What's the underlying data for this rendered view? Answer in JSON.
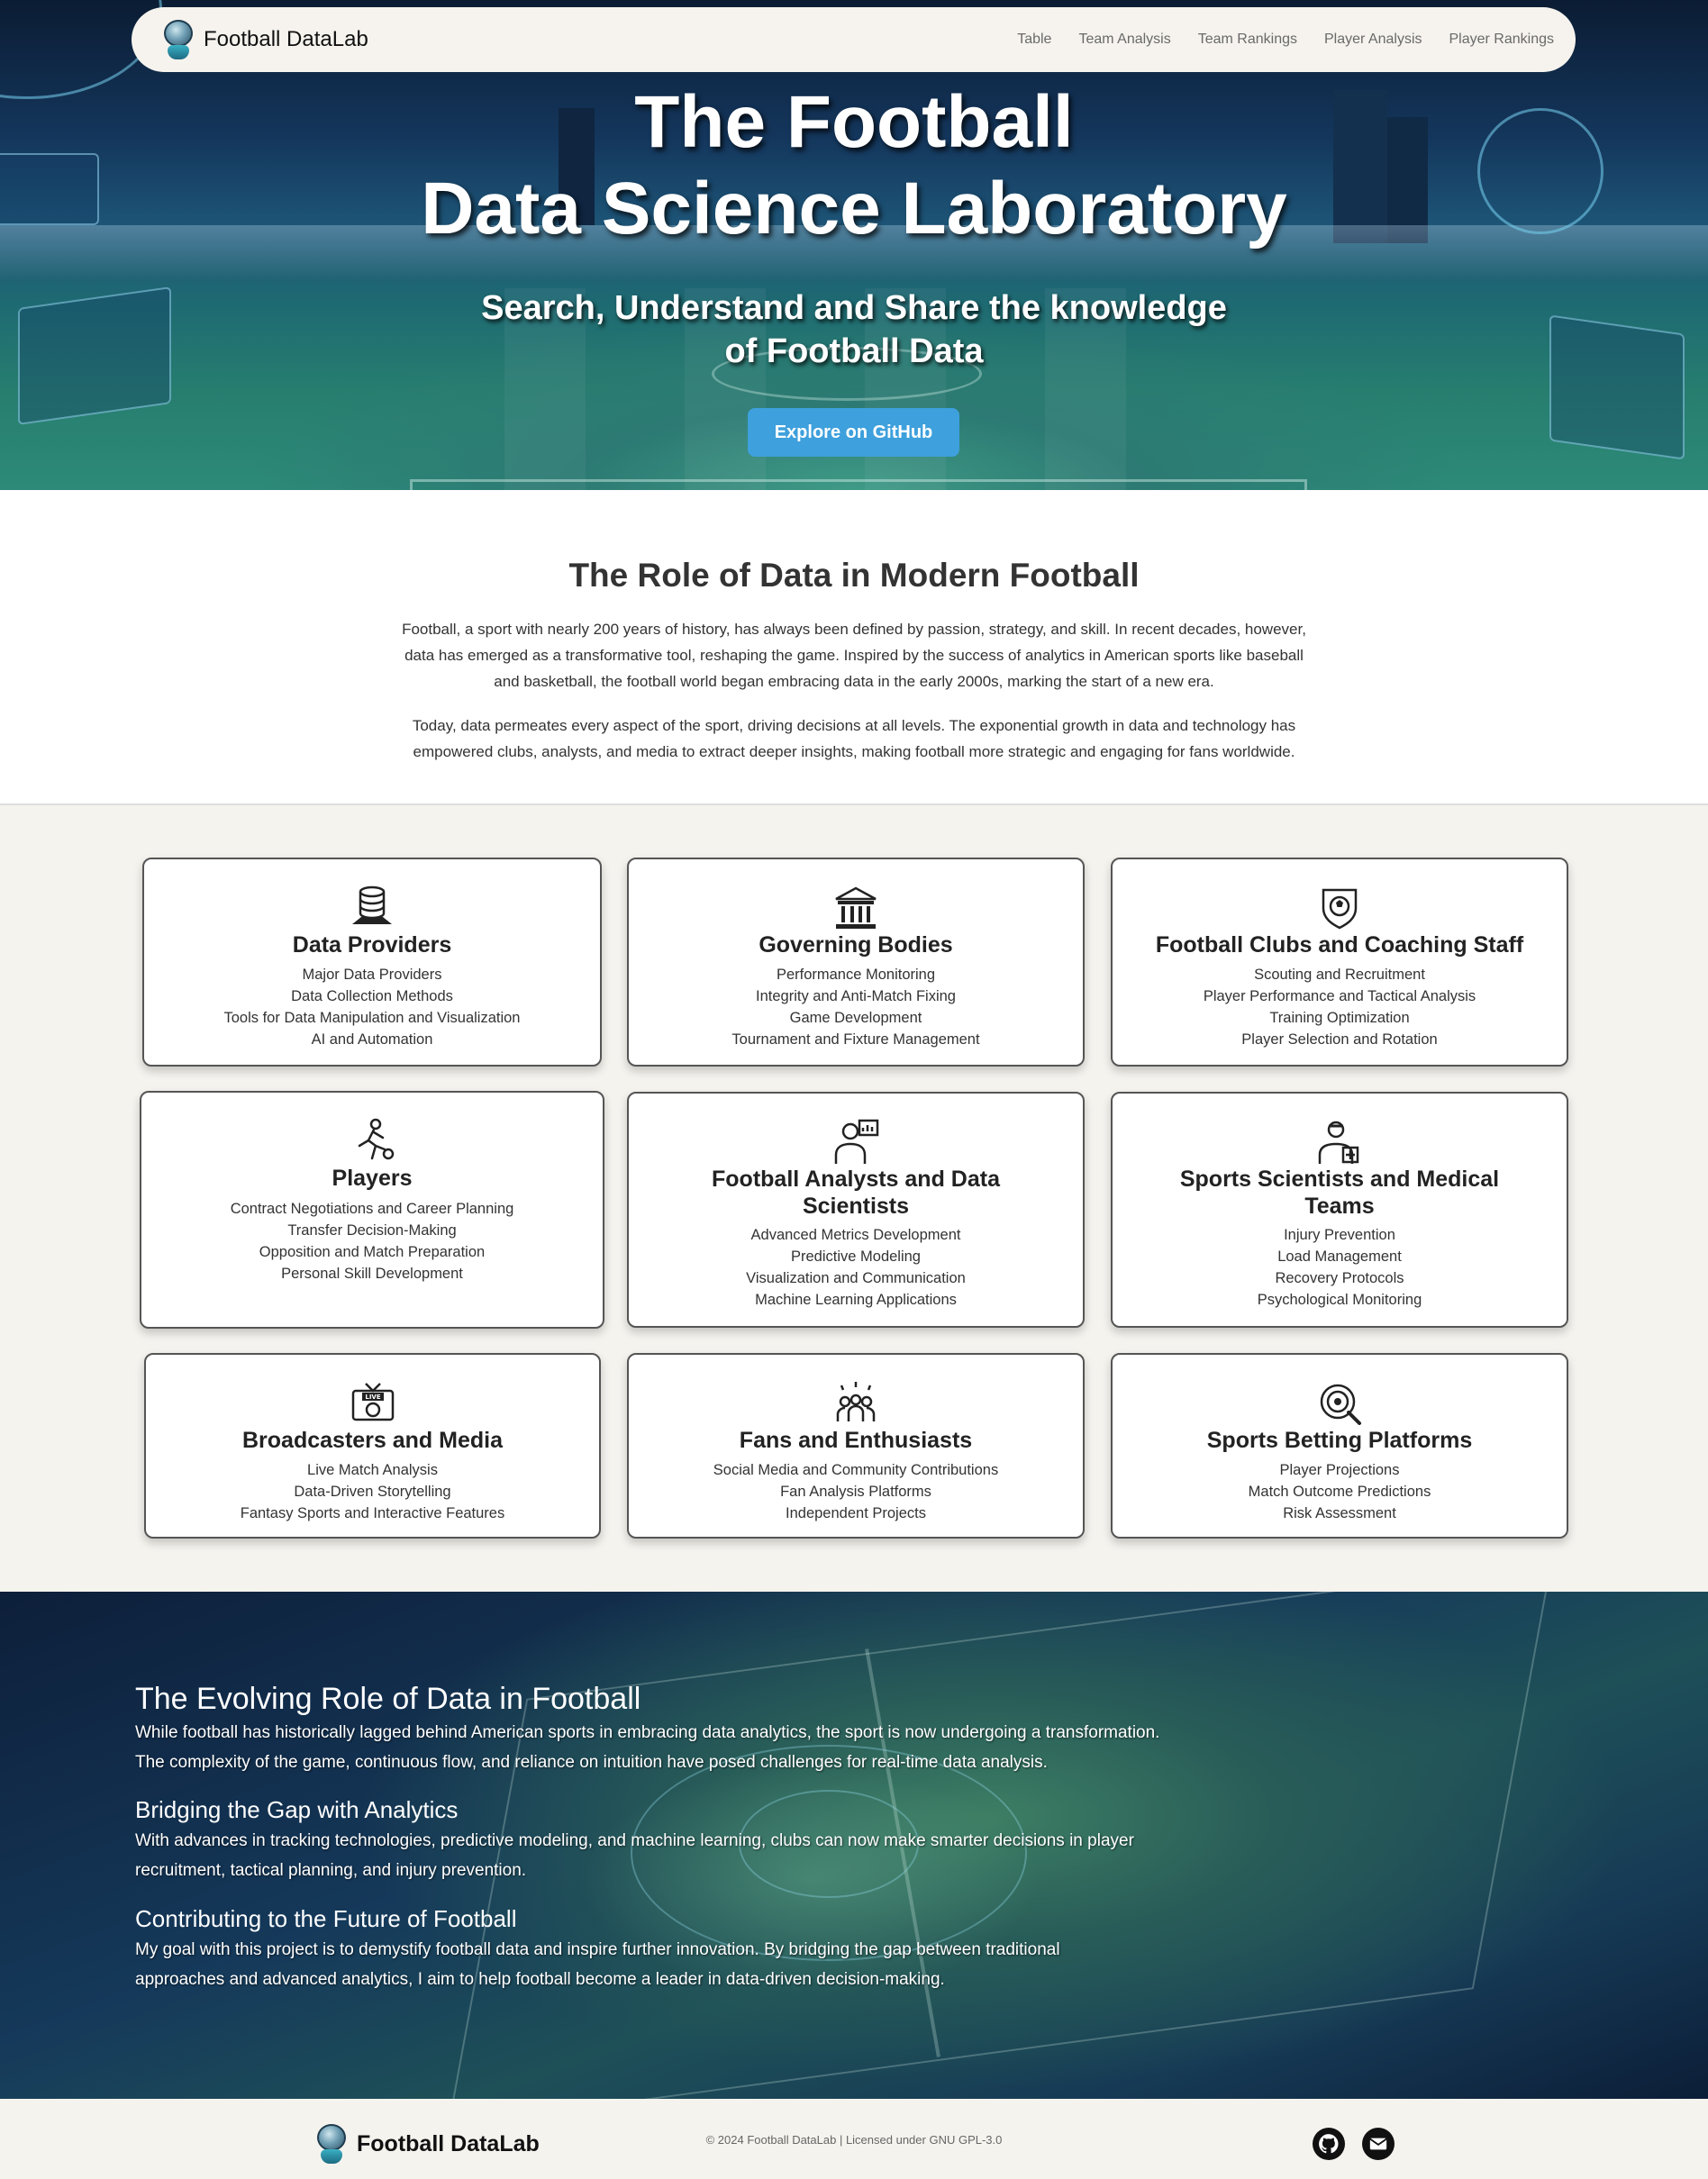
{
  "navbar": {
    "brand": "Football DataLab",
    "links": [
      "Table",
      "Team Analysis",
      "Team Rankings",
      "Player Analysis",
      "Player Rankings"
    ]
  },
  "hero": {
    "title_line1": "The Football",
    "title_line2": "Data Science Laboratory",
    "subtitle_line1": "Search, Understand and Share the knowledge",
    "subtitle_line2": "of Football Data",
    "cta": "Explore on GitHub"
  },
  "intro": {
    "heading": "The Role of Data in Modern Football",
    "p1_lines": [
      "Football, a sport with nearly 200 years of history, has always been defined by passion, strategy, and skill. In recent decades, however,",
      "data has emerged as a transformative tool, reshaping the game. Inspired by the success of analytics in American sports like baseball",
      "and basketball, the football world began embracing data in the early 2000s, marking the start of a new era."
    ],
    "p2_lines": [
      "Today, data permeates every aspect of the sport, driving decisions at all levels. The exponential growth in data and technology has",
      "empowered clubs, analysts, and media to extract deeper insights, making football more strategic and engaging for fans worldwide."
    ]
  },
  "cards": [
    {
      "title": "Data Providers",
      "icon": "database-icon",
      "items": [
        "Major Data Providers",
        "Data Collection Methods",
        "Tools for Data Manipulation and Visualization",
        "AI and Automation"
      ]
    },
    {
      "title": "Governing Bodies",
      "icon": "institution-icon",
      "items": [
        "Performance Monitoring",
        "Integrity and Anti-Match Fixing",
        "Game Development",
        "Tournament and Fixture Management"
      ]
    },
    {
      "title": "Football Clubs and Coaching Staff",
      "icon": "club-crest-icon",
      "items": [
        "Scouting and Recruitment",
        "Player Performance and Tactical Analysis",
        "Training Optimization",
        "Player Selection and Rotation"
      ]
    },
    {
      "title": "Players",
      "icon": "player-kicking-icon",
      "items": [
        "Contract Negotiations and Career Planning",
        "Transfer Decision-Making",
        "Opposition and Match Preparation",
        "Personal Skill Development"
      ]
    },
    {
      "title_line1": "Football Analysts and Data",
      "title_line2": "Scientists",
      "icon": "analyst-icon",
      "items": [
        "Advanced Metrics Development",
        "Predictive Modeling",
        "Visualization and Communication",
        "Machine Learning Applications"
      ]
    },
    {
      "title_line1": "Sports Scientists and Medical",
      "title_line2": "Teams",
      "icon": "medical-staff-icon",
      "items": [
        "Injury Prevention",
        "Load Management",
        "Recovery Protocols",
        "Psychological Monitoring"
      ]
    },
    {
      "title": "Broadcasters and Media",
      "icon": "live-tv-icon",
      "items": [
        "Live Match Analysis",
        "Data-Driven Storytelling",
        "Fantasy Sports and Interactive Features"
      ]
    },
    {
      "title": "Fans and Enthusiasts",
      "icon": "fans-icon",
      "items": [
        "Social Media and Community Contributions",
        "Fan Analysis Platforms",
        "Independent Projects"
      ]
    },
    {
      "title": "Sports Betting Platforms",
      "icon": "betting-target-icon",
      "items": [
        "Player Projections",
        "Match Outcome Predictions",
        "Risk Assessment"
      ]
    }
  ],
  "evolve": {
    "h1": "The Evolving Role of Data in Football",
    "p1_lines": [
      "While football has historically lagged behind American sports in embracing data analytics, the sport is now undergoing a transformation.",
      "The complexity of the game, continuous flow, and reliance on intuition have posed challenges for real-time data analysis."
    ],
    "h2": "Bridging the Gap with Analytics",
    "p2_lines": [
      "With advances in tracking technologies, predictive modeling, and machine learning, clubs can now make smarter decisions in player",
      "recruitment, tactical planning, and injury prevention."
    ],
    "h3": "Contributing to the Future of Football",
    "p3_lines": [
      "My goal with this project is to demystify football data and inspire further innovation. By bridging the gap between traditional",
      "approaches and advanced analytics, I aim to help football become a leader in data-driven decision-making."
    ]
  },
  "footer": {
    "brand": "Football DataLab",
    "copyright": "© 2024 Football DataLab | Licensed under GNU GPL-3.0",
    "social": [
      "github-icon",
      "email-icon"
    ]
  },
  "colors": {
    "cta": "#3ea0dc",
    "page_bg": "#f5f3ee",
    "navbar_bg": "#f6f3ee"
  }
}
